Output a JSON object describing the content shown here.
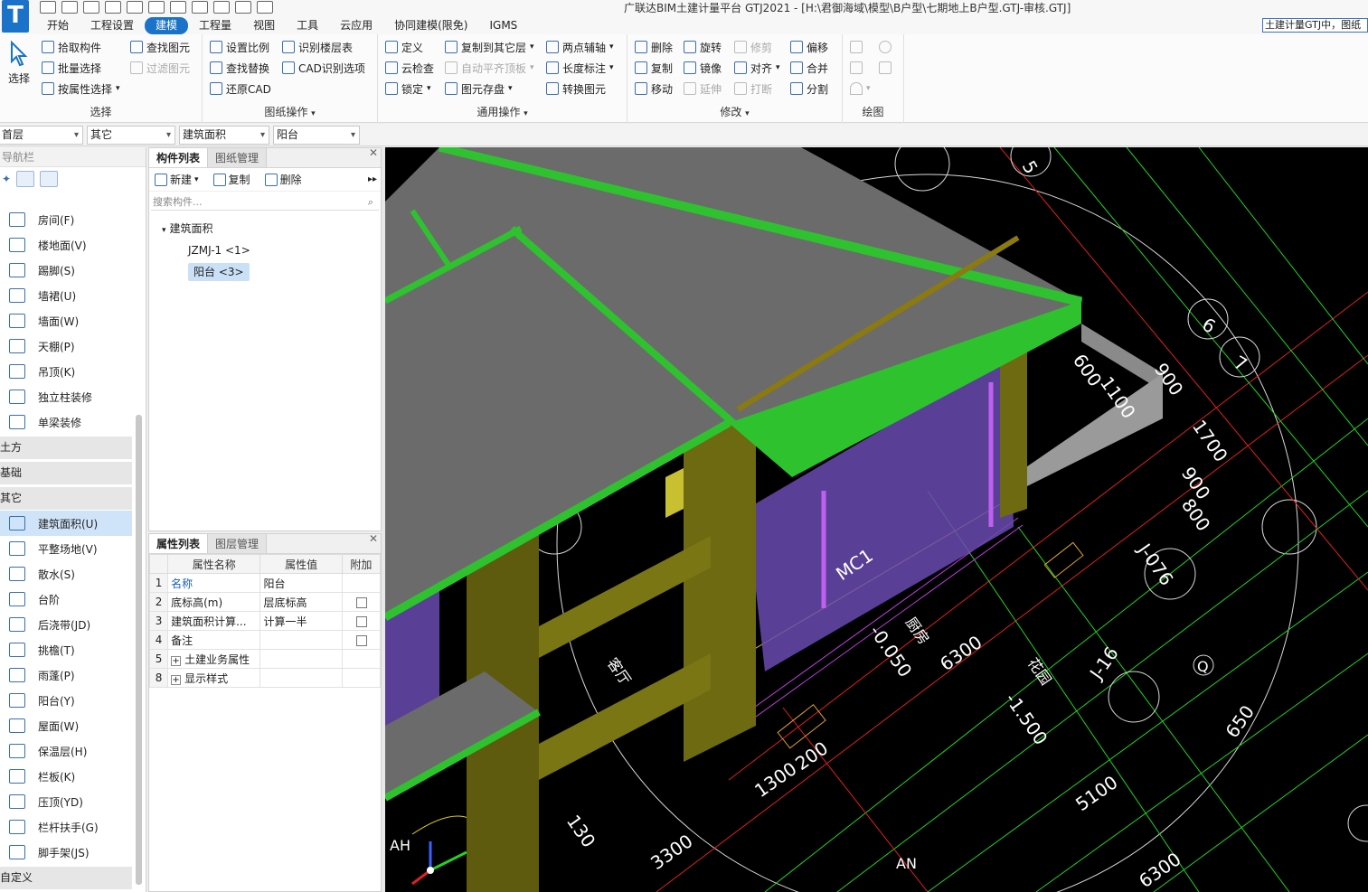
{
  "window": {
    "title": "广联达BIM土建计量平台 GTJ2021 - [H:\\君御海域\\模型\\B户型\\七期地上B户型.GTJ-审核.GTJ]",
    "search_text": "土建计量GTJ中，图纸"
  },
  "menu": {
    "tabs": [
      "开始",
      "工程设置",
      "建模",
      "工程量",
      "视图",
      "工具",
      "云应用",
      "协同建模(限免)",
      "IGMS"
    ],
    "active": "建模"
  },
  "ribbon": {
    "select_big": "选择",
    "select_group": {
      "label": "选择",
      "btn_pick": "拾取构件",
      "btn_batch": "批量选择",
      "btn_attr": "按属性选择",
      "btn_find": "查找图元",
      "btn_filter": "过滤图元"
    },
    "drawing_group": {
      "label": "图纸操作",
      "btn_scale": "设置比例",
      "btn_find_replace": "查找替换",
      "btn_restore": "还原CAD",
      "btn_identify_floor": "识别楼层表",
      "btn_cad_options": "CAD识别选项"
    },
    "general_group": {
      "label": "通用操作",
      "btn_define": "定义",
      "btn_cloud_check": "云检查",
      "btn_lock": "锁定",
      "btn_copy_floor": "复制到其它层",
      "btn_auto_level": "自动平齐顶板",
      "btn_save_elem": "图元存盘",
      "btn_two_point_axis": "两点辅轴",
      "btn_length_dim": "长度标注",
      "btn_convert": "转换图元"
    },
    "modify_group": {
      "label": "修改",
      "btn_delete": "删除",
      "btn_copy": "复制",
      "btn_move": "移动",
      "btn_rotate": "旋转",
      "btn_mirror": "镜像",
      "btn_extend": "延伸",
      "btn_trim": "修剪",
      "btn_align": "对齐",
      "btn_break": "打断",
      "btn_offset": "偏移",
      "btn_merge": "合并",
      "btn_split": "分割"
    },
    "draw_group": {
      "label": "绘图"
    }
  },
  "selector": {
    "floor": "首层",
    "category": "其它",
    "type": "建筑面积",
    "component": "阳台"
  },
  "nav": {
    "header": "导航栏",
    "items_top": [
      {
        "label": "房间(F)"
      },
      {
        "label": "楼地面(V)"
      },
      {
        "label": "踢脚(S)"
      },
      {
        "label": "墙裙(U)"
      },
      {
        "label": "墙面(W)"
      },
      {
        "label": "天棚(P)"
      },
      {
        "label": "吊顶(K)"
      },
      {
        "label": "独立柱装修"
      },
      {
        "label": "单梁装修"
      }
    ],
    "cat_earth": "土方",
    "cat_foundation": "基础",
    "cat_other": "其它",
    "items_other": [
      {
        "label": "建筑面积(U)"
      },
      {
        "label": "平整场地(V)"
      },
      {
        "label": "散水(S)"
      },
      {
        "label": "台阶"
      },
      {
        "label": "后浇带(JD)"
      },
      {
        "label": "挑檐(T)"
      },
      {
        "label": "雨蓬(P)"
      },
      {
        "label": "阳台(Y)"
      },
      {
        "label": "屋面(W)"
      },
      {
        "label": "保温层(H)"
      },
      {
        "label": "栏板(K)"
      },
      {
        "label": "压顶(YD)"
      },
      {
        "label": "栏杆扶手(G)"
      },
      {
        "label": "脚手架(JS)"
      }
    ],
    "cat_custom": "自定义",
    "selected": "建筑面积(U)"
  },
  "component_panel": {
    "tab_list": "构件列表",
    "tab_drawing": "图纸管理",
    "btn_new": "新建",
    "btn_copy": "复制",
    "btn_delete": "删除",
    "search_placeholder": "搜索构件...",
    "tree_group": "建筑面积",
    "tree_items": [
      "JZMJ-1 <1>",
      "阳台 <3>"
    ],
    "selected": "阳台 <3>"
  },
  "property_panel": {
    "tab_props": "属性列表",
    "tab_layers": "图层管理",
    "col_name": "属性名称",
    "col_value": "属性值",
    "col_extra": "附加",
    "rows": [
      {
        "num": "1",
        "name": "名称",
        "value": "阳台",
        "checkbox": false
      },
      {
        "num": "2",
        "name": "底标高(m)",
        "value": "层底标高",
        "checkbox": true
      },
      {
        "num": "3",
        "name": "建筑面积计算...",
        "value": "计算一半",
        "checkbox": true
      },
      {
        "num": "4",
        "name": "备注",
        "value": "",
        "checkbox": true
      },
      {
        "num": "5",
        "name": "土建业务属性",
        "value": "",
        "checkbox": false,
        "expandable": true
      },
      {
        "num": "8",
        "name": "显示样式",
        "value": "",
        "checkbox": false,
        "expandable": true
      }
    ]
  },
  "canvas": {
    "labels": {
      "dim_6300a": "6300",
      "dim_6300b": "6300",
      "dim_5100": "5100",
      "dim_3300": "3300",
      "dim_1300": "1300",
      "dim_200": "200",
      "dim_900a": "900",
      "dim_900b": "900",
      "dim_800": "800",
      "dim_1700": "1700",
      "dim_600": "600",
      "dim_1100": "1100",
      "dim_650": "650",
      "dim_130": "130",
      "elev_0050": "-0.050",
      "elev_1500": "-1.500",
      "axis_5": "5",
      "axis_6": "6",
      "axis_7": "7",
      "axis_q": "Q",
      "door_mc1": "MC1",
      "room_kitchen": "厨房",
      "room_living": "客厅",
      "room_garden": "花园",
      "detail_j076": "J-076",
      "detail_j16": "J-16",
      "label_ah": "AH",
      "label_an": "AN"
    },
    "colors": {
      "slab_gray": "#6b6b6b",
      "slab_edge_green": "#2fc22f",
      "beam_olive": "#6e6a12",
      "wall_purple": "#6a4ab0",
      "cad_green": "#22d422",
      "cad_red": "#e02020",
      "cad_white": "#d8d8d8",
      "cad_magenta": "#c040e0",
      "cad_yellow": "#e0d020"
    }
  }
}
